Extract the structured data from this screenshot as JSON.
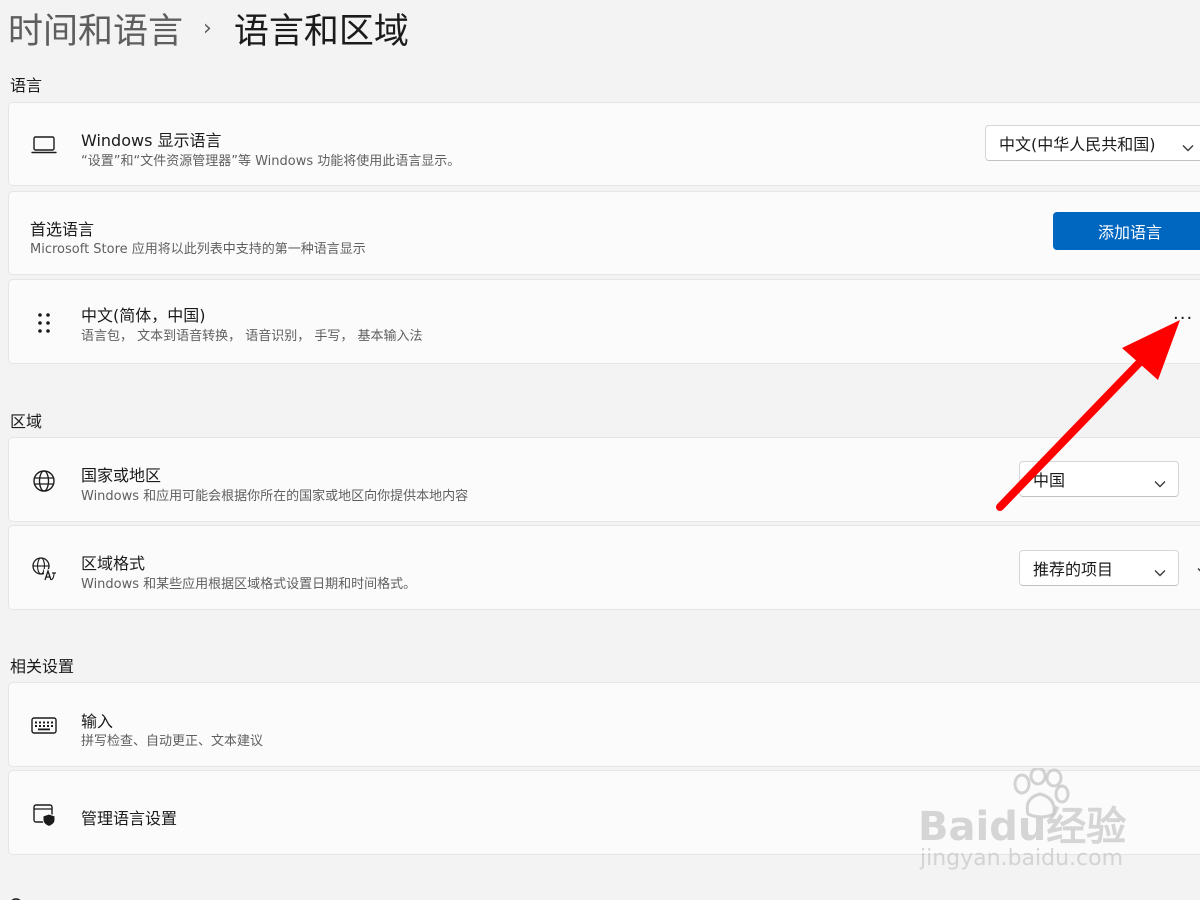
{
  "breadcrumb": {
    "parent": "时间和语言",
    "separator": "›",
    "current": "语言和区域"
  },
  "sections": {
    "language": "语言",
    "region": "区域",
    "related": "相关设置"
  },
  "display_language": {
    "title": "Windows 显示语言",
    "subtitle": "“设置”和“文件资源管理器”等 Windows 功能将使用此语言显示。",
    "value": "中文(中华人民共和国)",
    "icon": "laptop-icon"
  },
  "preferred_language": {
    "title": "首选语言",
    "subtitle": "Microsoft Store 应用将以此列表中支持的第一种语言显示",
    "button": "添加语言"
  },
  "language_item": {
    "title": "中文(简体，中国)",
    "subtitle": "语言包， 文本到语音转换， 语音识别， 手写， 基本输入法",
    "more": "···",
    "icon": "drag-handle-icon"
  },
  "country": {
    "title": "国家或地区",
    "subtitle": "Windows 和应用可能会根据你所在的国家或地区向你提供本地内容",
    "value": "中国",
    "icon": "globe-icon"
  },
  "regional_format": {
    "title": "区域格式",
    "subtitle": "Windows 和某些应用根据区域格式设置日期和时间格式。",
    "value": "推荐的项目",
    "icon": "language-format-icon"
  },
  "typing": {
    "title": "输入",
    "subtitle": "拼写检查、自动更正、文本建议",
    "icon": "keyboard-icon"
  },
  "admin_language": {
    "title": "管理语言设置",
    "icon": "admin-shield-icon"
  },
  "watermark": {
    "brand": "Baidu经验",
    "url": "jingyan.baidu.com"
  },
  "colors": {
    "accent": "#0067c0",
    "annotation_arrow": "#ff0000",
    "background": "#f3f3f3",
    "card": "#fbfbfb"
  }
}
